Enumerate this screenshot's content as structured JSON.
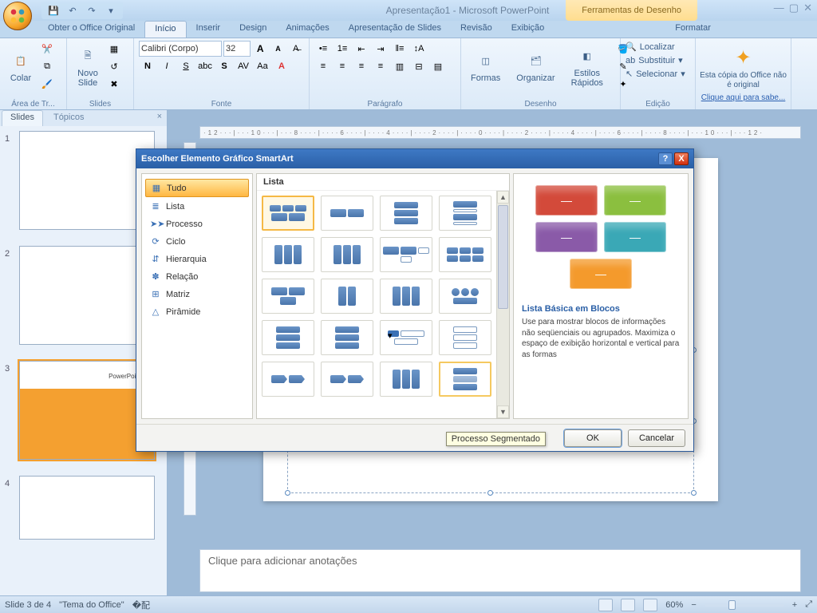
{
  "titlebar": {
    "title": "Apresentação1 - Microsoft PowerPoint",
    "context_tab": "Ferramentas de Desenho"
  },
  "tabs": {
    "office_original": "Obter o Office Original",
    "home": "Início",
    "insert": "Inserir",
    "design": "Design",
    "animations": "Animações",
    "slideshow": "Apresentação de Slides",
    "review": "Revisão",
    "view": "Exibição",
    "format": "Formatar"
  },
  "ribbon": {
    "clipboard": {
      "paste": "Colar",
      "group": "Área de Tr..."
    },
    "slides": {
      "new_slide": "Novo\nSlide",
      "group": "Slides"
    },
    "font": {
      "name": "Calibri (Corpo)",
      "size": "32",
      "group": "Fonte"
    },
    "paragraph": {
      "group": "Parágrafo"
    },
    "drawing": {
      "shapes": "Formas",
      "arrange": "Organizar",
      "quick": "Estilos\nRápidos",
      "group": "Desenho"
    },
    "editing": {
      "find": "Localizar",
      "replace": "Substituir",
      "select": "Selecionar",
      "group": "Edição"
    },
    "notice": {
      "line1": "Esta cópia do Office não é original",
      "link": "Clique aqui para sabe..."
    }
  },
  "panel": {
    "slides": "Slides",
    "outline": "Tópicos",
    "thumb3_text": "PowerPoint"
  },
  "ruler_ticks": "·12···|···10···|···8····|····6····|····4····|····2····|····0····|····2····|····4····|····6····|····8····|···10···|···12·",
  "notes_placeholder": "Clique para adicionar anotações",
  "status": {
    "slide": "Slide 3 de 4",
    "theme": "\"Tema do Office\"",
    "lang": "",
    "zoom": "60%"
  },
  "dialog": {
    "title": "Escolher Elemento Gráfico SmartArt",
    "cats": {
      "all": "Tudo",
      "list": "Lista",
      "process": "Processo",
      "cycle": "Ciclo",
      "hierarchy": "Hierarquia",
      "relationship": "Relação",
      "matrix": "Matriz",
      "pyramid": "Pirâmide"
    },
    "gallery_head": "Lista",
    "preview": {
      "title": "Lista Básica em Blocos",
      "desc": "Use para mostrar blocos de informações não seqüenciais ou agrupados. Maximiza o espaço de exibição horizontal e vertical para as formas"
    },
    "tooltip": "Processo Segmentado",
    "ok": "OK",
    "cancel": "Cancelar"
  }
}
